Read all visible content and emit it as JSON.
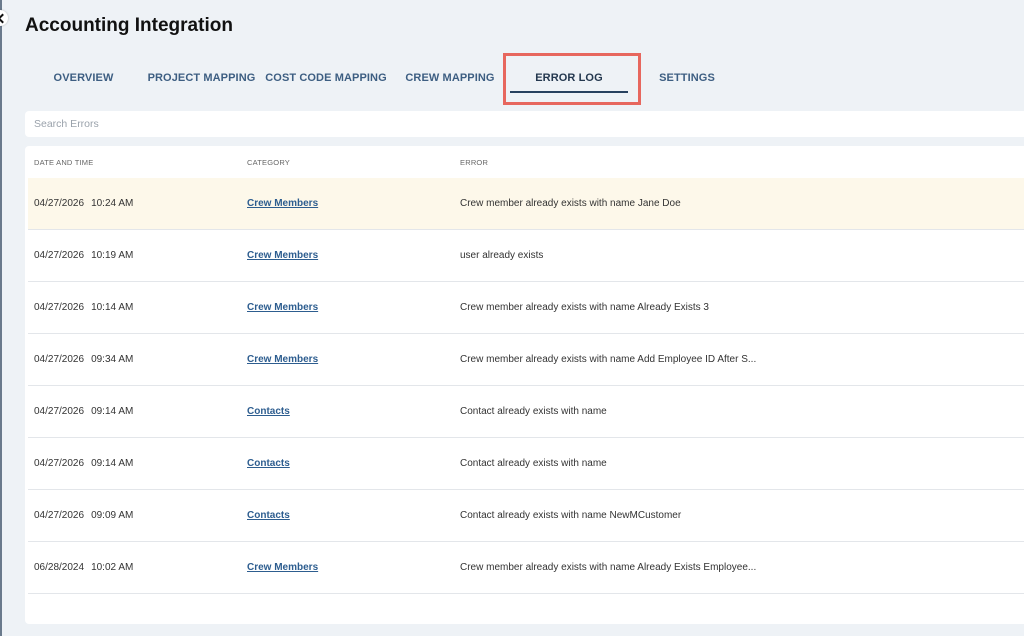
{
  "page_title": "Accounting Integration",
  "tabs": [
    {
      "label": "OVERVIEW"
    },
    {
      "label": "PROJECT MAPPING"
    },
    {
      "label": "COST CODE MAPPING"
    },
    {
      "label": "CREW MAPPING"
    },
    {
      "label": "ERROR LOG",
      "active": true
    },
    {
      "label": "SETTINGS"
    }
  ],
  "search": {
    "placeholder": "Search Errors",
    "value": ""
  },
  "table": {
    "headers": [
      "DATE AND TIME",
      "CATEGORY",
      "ERROR"
    ],
    "rows": [
      {
        "date": "04/27/2026",
        "time": "10:24 AM",
        "category": "Crew Members",
        "error": "Crew member already exists with name Jane Doe"
      },
      {
        "date": "04/27/2026",
        "time": "10:19 AM",
        "category": "Crew Members",
        "error": "user already exists"
      },
      {
        "date": "04/27/2026",
        "time": "10:14 AM",
        "category": "Crew Members",
        "error": "Crew member already exists with name Already Exists 3"
      },
      {
        "date": "04/27/2026",
        "time": "09:34 AM",
        "category": "Crew Members",
        "error": "Crew member already exists with name Add Employee ID After S..."
      },
      {
        "date": "04/27/2026",
        "time": "09:14 AM",
        "category": "Contacts",
        "error": "Contact already exists with name"
      },
      {
        "date": "04/27/2026",
        "time": "09:14 AM",
        "category": "Contacts",
        "error": "Contact already exists with name"
      },
      {
        "date": "04/27/2026",
        "time": "09:09 AM",
        "category": "Contacts",
        "error": "Contact already exists with name NewMCustomer"
      },
      {
        "date": "06/28/2024",
        "time": "10:02 AM",
        "category": "Crew Members",
        "error": "Crew member already exists with name Already Exists Employee..."
      }
    ]
  },
  "colors": {
    "background": "#eef2f6",
    "tab_text": "#3d5e82",
    "active_tab_underline": "#27415f",
    "highlight_box": "#e7675e",
    "hover_row": "#fdf8ea",
    "link": "#2d5d8f"
  },
  "icons": {
    "back": "chevron-left-icon"
  }
}
